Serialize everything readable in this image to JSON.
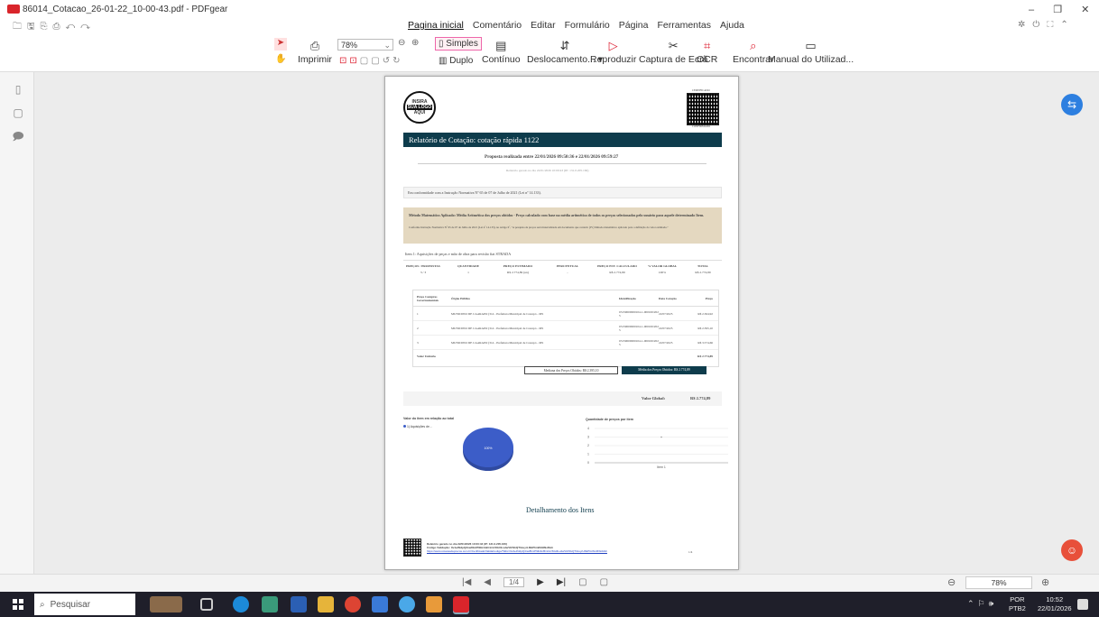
{
  "window": {
    "title": "86014_Cotacao_26-01-22_10-00-43.pdf - PDFgear",
    "controls": {
      "minimize": "–",
      "restore": "❐",
      "close": "✕"
    }
  },
  "menu": [
    "Pagina inicial",
    "Comentário",
    "Editar",
    "Formulário",
    "Página",
    "Ferramentas",
    "Ajuda"
  ],
  "toolbar": {
    "print": "Imprimir",
    "zoom": "78%",
    "simple": "Simples",
    "double": "Duplo",
    "continuous": "Contínuo",
    "scroll": "Deslocamento... ▾",
    "reproduce": "Reproduzir",
    "capture": "Captura de Ecrã",
    "ocr": "OCR",
    "find": "Encontrar",
    "manual": "Manual do Utilizad..."
  },
  "pdf": {
    "logo": [
      "INSIRA",
      "SUA LOGO",
      "AQUI"
    ],
    "cert_top": "CERTIFICADO",
    "cert_bottom": "CONFIRMADO",
    "title": "Relatório de Cotação: cotação rápida 1122",
    "subtitle": "Proposta realizada entre 22/01/2026 09:50:36 e 22/01/2026 09:59:27",
    "generated_line": "Relatório gerado no dia 22/01/2026 10:00:43 (IP: 131.0.205.166)",
    "conformity": "Em conformidade com a Instrução Normativa Nº 65 de 07 de Julho de 2021 (Lei nº 14.133).",
    "method_title": "Método Matemático Aplicado: Média Aritmética dos preços obtidos - Preço calculado com base na média aritmética de todos os preços selecionados pelo usuário para aquele determinado Item.",
    "method_note": "Conforme Instrução Normativa Nº 65 de 07 de Julho de 2021 (Lei nº 14.133), no Artigo 6º, \"A pesquisa de preços será materializada em documento que conterá: (IV) Método matemático aplicado para a definição do valor estimado.\"",
    "item_title": "Item 1: Aquisições de peças e mão de obra para revisão fiat STRADA",
    "summary_headers": [
      "PREÇOS / PROPOSTAS",
      "QUANTIDADE",
      "PREÇO ESTIMADO",
      "PERCENTUAL",
      "PREÇO EST. CALCULADO",
      "% VALOR GLOBAL",
      "TOTAL"
    ],
    "summary_values": [
      "3 / 3",
      "1",
      "R$ 2.774,89 (un)",
      "-",
      "R$ 2.774,89",
      "100%",
      "R$ 2.774,89"
    ],
    "detail_headers": [
      "Preço Compras Governamentais",
      "Órgão Público",
      "Identificação",
      "Data Cotação",
      "Preço"
    ],
    "rows": [
      [
        "1",
        "MUNICIPIO DE CAARAPO (314 - Prefeitura Municipal de Caarapó - MS",
        "03159000000104-1-000100/2025",
        "22/07/2025",
        "R$ 2.364,92"
      ],
      [
        "2",
        "MUNICIPIO DE CAARAPO (314 - Prefeitura Municipal de Caarapó - MS",
        "03159000000104-1-000100/2025",
        "22/07/2025",
        "R$ 2.395,10"
      ],
      [
        "3",
        "MUNICIPIO DE CAARAPO (314 - Prefeitura Municipal de Caarapó - MS",
        "03159000000104-1-000100/2025",
        "22/07/2025",
        "R$ 3.574,66"
      ]
    ],
    "unit_value_label": "Valor Unitário",
    "unit_value": "R$ 2.774,89",
    "median": "Mediana dos Preços Obtidos: R$ 2.395,10",
    "mean": "Média dos Preços Obtidos: R$ 2.774,89",
    "global_label": "Valor Global:",
    "global_value": "R$ 2.774,89",
    "pie_title": "Valor do item em relação ao total",
    "pie_legend": "1) Aquisições de...",
    "pie_label": "100%",
    "bar_title": "Quantidade de preços por item",
    "bar_axis": "Item 1",
    "detail_section": "Detalhamento dos Itens",
    "footer1": "Relatório gerado no dia 22/01/2026 10:00:43 (IP: 131.0.205.166)",
    "footer2": "Código Validação: 0v4eJNdpQ3nw8bnPNibi4nBr4oVz6Gl4LvdwVIZ3GQT3cuyrL8tkPlmWxM/9oMsh",
    "footer3": "https://www.cotacaodeprecos.com.br/Certificado/ValidaCodigo/?lkbc=0v4eJNdpQ3nw8bnPNibi4nBr4oVz6Gl4LvdwVIZ3GQT3cuyrL8tkPlmWxM/9oMsh",
    "page_number": "1/4"
  },
  "chart_data": [
    {
      "type": "pie",
      "title": "Valor do item em relação ao total",
      "categories": [
        "1) Aquisições de..."
      ],
      "values": [
        100
      ]
    },
    {
      "type": "bar",
      "title": "Quantidade de preços por item",
      "categories": [
        "Item 1"
      ],
      "values": [
        3
      ],
      "ylim": [
        0,
        4
      ],
      "yticks": [
        0,
        1,
        2,
        3,
        4
      ]
    }
  ],
  "status": {
    "page": "1/4",
    "zoom": "78%"
  },
  "taskbar": {
    "search": "Pesquisar",
    "lang1": "POR",
    "lang2": "PTB2",
    "time": "10:52",
    "date": "22/01/2026"
  },
  "colors": {
    "accent": "#0e3c4c",
    "pdfgear_red": "#d9252b",
    "taskbar": "#1f1f2a",
    "pie": "#3c5dc8"
  }
}
